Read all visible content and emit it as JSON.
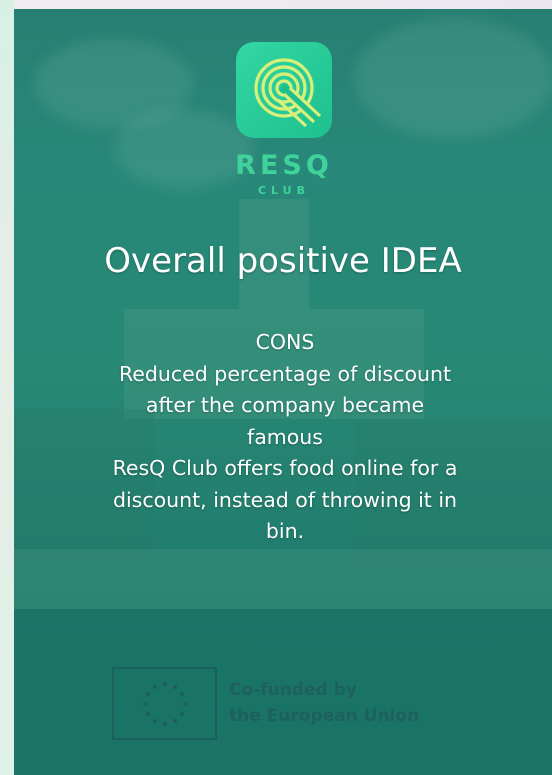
{
  "brand": {
    "logo_icon": "resq-q-logo-icon",
    "name": "RESQ",
    "sub": "CLUB",
    "accent_color": "#3fd39b"
  },
  "slide": {
    "headline": "Overall positive IDEA",
    "lines": [
      "CONS",
      "Reduced percentage of discount",
      "after the company became",
      "famous",
      "ResQ Club offers food online for a",
      "discount, instead of throwing it in",
      "bin."
    ]
  },
  "footer": {
    "eu_flag_icon": "eu-flag-icon",
    "lines": [
      "Co-funded by",
      "the European Union"
    ]
  }
}
